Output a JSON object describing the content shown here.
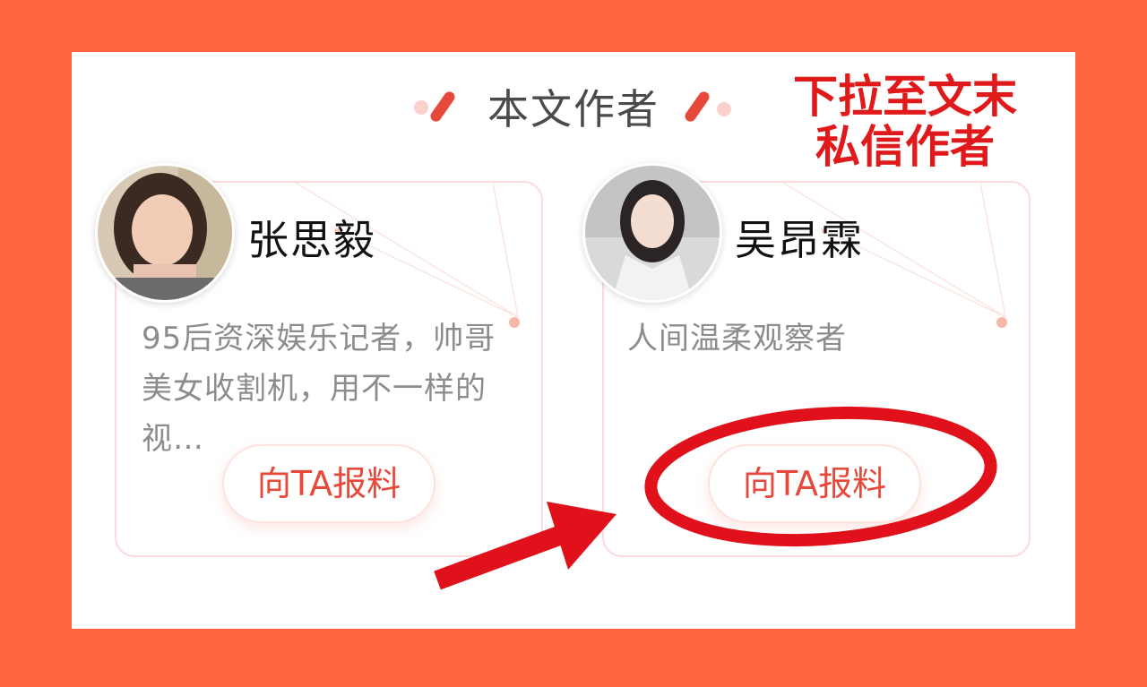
{
  "colors": {
    "frame": "#ff6441",
    "panel": "#ffffff",
    "accent": "#e8483a",
    "annotation": "#e0191b",
    "card_border": "#fbdada"
  },
  "section": {
    "title": "本文作者"
  },
  "annotation": {
    "line1": "下拉至文末",
    "line2": "私信作者"
  },
  "authors": [
    {
      "name": "张思毅",
      "bio": "95后资深娱乐记者，帅哥美女收割机，用不一样的视…",
      "button_label": "向TA报料",
      "avatar_icon": "avatar-photo-female"
    },
    {
      "name": "吴昂霖",
      "bio": "人间温柔观察者",
      "button_label": "向TA报料",
      "avatar_icon": "avatar-photo-female"
    }
  ]
}
